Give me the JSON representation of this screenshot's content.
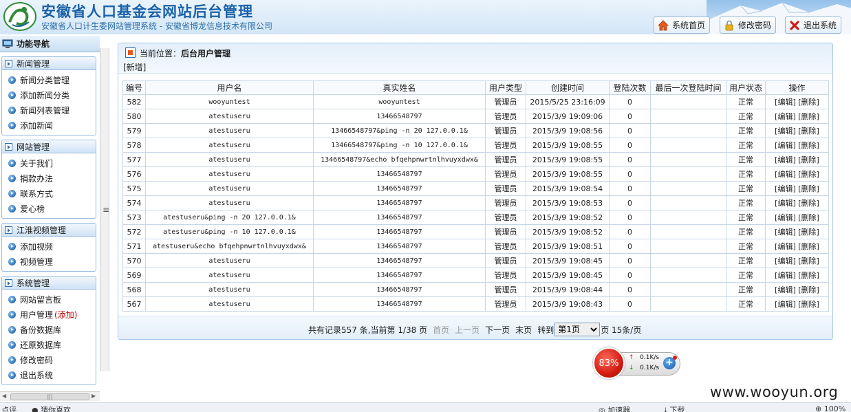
{
  "header": {
    "title": "安徽省人口基金会网站后台管理",
    "subtitle": "安徽省人口计生委网站管理系统 - 安徽省博龙信息技术有限公司",
    "buttons": [
      {
        "label": "系统首页",
        "icon": "home-icon"
      },
      {
        "label": "修改密码",
        "icon": "lock-icon"
      },
      {
        "label": "退出系统",
        "icon": "exit-icon"
      }
    ]
  },
  "sidebar": {
    "title": "功能导航",
    "groups": [
      {
        "title": "新闻管理",
        "items": [
          "新闻分类管理",
          "添加新闻分类",
          "新闻列表管理",
          "添加新闻"
        ]
      },
      {
        "title": "网站管理",
        "items": [
          "关于我们",
          "捐款办法",
          "联系方式",
          "爱心榜"
        ]
      },
      {
        "title": "江淮视频管理",
        "items": [
          "添加视频",
          "视频管理"
        ]
      },
      {
        "title": "系统管理",
        "items": [
          "网站留言板",
          "用户管理",
          "备份数据库",
          "还原数据库",
          "修改密码",
          "退出系统"
        ]
      }
    ],
    "user_mgmt_tag": "(添加)"
  },
  "main": {
    "location_prefix": "当前位置：",
    "location": "后台用户管理",
    "add_link": "[新增]",
    "columns": [
      "编号",
      "用户名",
      "真实姓名",
      "用户类型",
      "创建时间",
      "登陆次数",
      "最后一次登陆时间",
      "用户状态",
      "操作"
    ],
    "rows": [
      {
        "id": "582",
        "username": "wooyuntest",
        "realname": "wooyuntest",
        "type": "管理员",
        "created": "2015/5/25 23:16:09",
        "logins": "0",
        "last": "",
        "status": "正常"
      },
      {
        "id": "580",
        "username": "atestuseru",
        "realname": "13466548797",
        "type": "管理员",
        "created": "2015/3/9 19:09:06",
        "logins": "0",
        "last": "",
        "status": "正常"
      },
      {
        "id": "579",
        "username": "atestuseru",
        "realname": "13466548797&ping -n 20 127.0.0.1&",
        "type": "管理员",
        "created": "2015/3/9 19:08:56",
        "logins": "0",
        "last": "",
        "status": "正常"
      },
      {
        "id": "578",
        "username": "atestuseru",
        "realname": "13466548797&ping -n 10 127.0.0.1&",
        "type": "管理员",
        "created": "2015/3/9 19:08:55",
        "logins": "0",
        "last": "",
        "status": "正常"
      },
      {
        "id": "577",
        "username": "atestuseru",
        "realname": "13466548797&echo bfqehpnwrtnlhvuyxdwx&",
        "type": "管理员",
        "created": "2015/3/9 19:08:55",
        "logins": "0",
        "last": "",
        "status": "正常"
      },
      {
        "id": "576",
        "username": "atestuseru",
        "realname": "13466548797",
        "type": "管理员",
        "created": "2015/3/9 19:08:55",
        "logins": "0",
        "last": "",
        "status": "正常"
      },
      {
        "id": "575",
        "username": "atestuseru",
        "realname": "13466548797",
        "type": "管理员",
        "created": "2015/3/9 19:08:54",
        "logins": "0",
        "last": "",
        "status": "正常"
      },
      {
        "id": "574",
        "username": "atestuseru",
        "realname": "13466548797",
        "type": "管理员",
        "created": "2015/3/9 19:08:53",
        "logins": "0",
        "last": "",
        "status": "正常"
      },
      {
        "id": "573",
        "username": "atestuseru&ping -n 20 127.0.0.1&",
        "realname": "13466548797",
        "type": "管理员",
        "created": "2015/3/9 19:08:52",
        "logins": "0",
        "last": "",
        "status": "正常"
      },
      {
        "id": "572",
        "username": "atestuseru&ping -n 10 127.0.0.1&",
        "realname": "13466548797",
        "type": "管理员",
        "created": "2015/3/9 19:08:52",
        "logins": "0",
        "last": "",
        "status": "正常"
      },
      {
        "id": "571",
        "username": "atestuseru&echo bfqehpnwrtnlhvuyxdwx&",
        "realname": "13466548797",
        "type": "管理员",
        "created": "2015/3/9 19:08:51",
        "logins": "0",
        "last": "",
        "status": "正常"
      },
      {
        "id": "570",
        "username": "atestuseru",
        "realname": "13466548797",
        "type": "管理员",
        "created": "2015/3/9 19:08:45",
        "logins": "0",
        "last": "",
        "status": "正常"
      },
      {
        "id": "569",
        "username": "atestuseru",
        "realname": "13466548797",
        "type": "管理员",
        "created": "2015/3/9 19:08:45",
        "logins": "0",
        "last": "",
        "status": "正常"
      },
      {
        "id": "568",
        "username": "atestuseru",
        "realname": "13466548797",
        "type": "管理员",
        "created": "2015/3/9 19:08:44",
        "logins": "0",
        "last": "",
        "status": "正常"
      },
      {
        "id": "567",
        "username": "atestuseru",
        "realname": "13466548797",
        "type": "管理员",
        "created": "2015/3/9 19:08:43",
        "logins": "0",
        "last": "",
        "status": "正常"
      }
    ],
    "op_edit": "[编辑]",
    "op_delete": "[删除]"
  },
  "pager": {
    "summary": "共有记录557 条,当前第 1/38 页",
    "first": "首页",
    "prev": "上一页",
    "next": "下一页",
    "last": "末页",
    "goto": "转到",
    "selected_page": "第1页",
    "page_suffix": "页 15条/页"
  },
  "network": {
    "percent": "83%",
    "up": "0.1K/s",
    "down": "0.1K/s"
  },
  "watermark": "www.wooyun.org",
  "statusbar": {
    "left1": "点评",
    "left2": "猜你喜欢",
    "accelerator": "加速器",
    "download": "下载",
    "zoom": "100%"
  },
  "colors": {
    "accent": "#1b62a8",
    "highlight": "#c00000",
    "network_ball": "#d21c12"
  }
}
